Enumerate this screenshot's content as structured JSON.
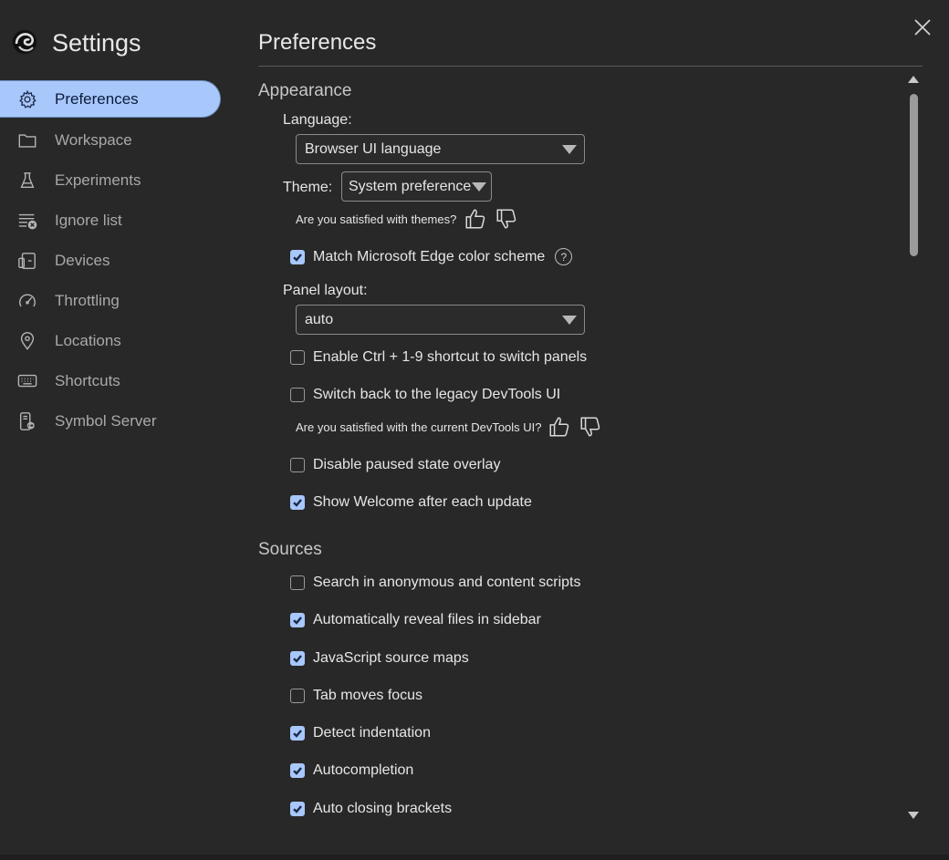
{
  "app": {
    "title": "Settings",
    "logo_icon": "edge-logo-icon"
  },
  "sidebar": {
    "items": [
      {
        "label": "Preferences",
        "icon": "gear-icon",
        "active": true
      },
      {
        "label": "Workspace",
        "icon": "folder-icon"
      },
      {
        "label": "Experiments",
        "icon": "flask-icon"
      },
      {
        "label": "Ignore list",
        "icon": "ignore-list-icon"
      },
      {
        "label": "Devices",
        "icon": "devices-icon"
      },
      {
        "label": "Throttling",
        "icon": "gauge-icon"
      },
      {
        "label": "Locations",
        "icon": "location-pin-icon"
      },
      {
        "label": "Shortcuts",
        "icon": "keyboard-icon"
      },
      {
        "label": "Symbol Server",
        "icon": "symbol-server-icon"
      }
    ]
  },
  "main": {
    "title": "Preferences",
    "appearance": {
      "title": "Appearance",
      "language_label": "Language:",
      "language_value": "Browser UI language",
      "theme_label": "Theme:",
      "theme_value": "System preference",
      "themes_feedback": "Are you satisfied with themes?",
      "match_scheme": {
        "label": "Match Microsoft Edge color scheme",
        "checked": true
      },
      "panel_layout_label": "Panel layout:",
      "panel_layout_value": "auto",
      "ctrl_shortcut": {
        "label": "Enable Ctrl + 1-9 shortcut to switch panels",
        "checked": false
      },
      "legacy_ui": {
        "label": "Switch back to the legacy DevTools UI",
        "checked": false
      },
      "devtools_feedback": "Are you satisfied with the current DevTools UI?",
      "disable_paused": {
        "label": "Disable paused state overlay",
        "checked": false
      },
      "show_welcome": {
        "label": "Show Welcome after each update",
        "checked": true
      }
    },
    "sources": {
      "title": "Sources",
      "options": [
        {
          "label": "Search in anonymous and content scripts",
          "checked": false
        },
        {
          "label": "Automatically reveal files in sidebar",
          "checked": true
        },
        {
          "label": "JavaScript source maps",
          "checked": true
        },
        {
          "label": "Tab moves focus",
          "checked": false
        },
        {
          "label": "Detect indentation",
          "checked": true
        },
        {
          "label": "Autocompletion",
          "checked": true
        },
        {
          "label": "Auto closing brackets",
          "checked": true
        }
      ]
    }
  },
  "colors": {
    "background": "#282828",
    "accent": "#a8c7fa",
    "text": "#e3e3e3"
  }
}
